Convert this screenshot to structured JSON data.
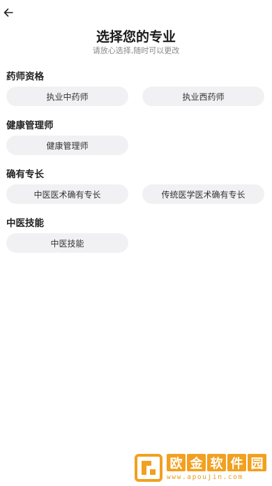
{
  "header": {
    "back_icon": "arrow-left-icon",
    "title": "选择您的专业",
    "subtitle": "请放心选择,随时可以更改"
  },
  "sections": [
    {
      "title": "药师资格",
      "options": [
        "执业中药师",
        "执业西药师"
      ]
    },
    {
      "title": "健康管理师",
      "options": [
        "健康管理师"
      ]
    },
    {
      "title": "确有专长",
      "options": [
        "中医医术确有专长",
        "传统医学医术确有专长"
      ]
    },
    {
      "title": "中医技能",
      "options": [
        "中医技能"
      ]
    }
  ],
  "watermark": {
    "name": "欧金软件园",
    "chars": [
      "欧",
      "金",
      "软",
      "件",
      "园"
    ],
    "url": "www.apoujin.com"
  },
  "colors": {
    "chip_bg": "#f1f1f3",
    "watermark_orange": "#f2a020"
  }
}
